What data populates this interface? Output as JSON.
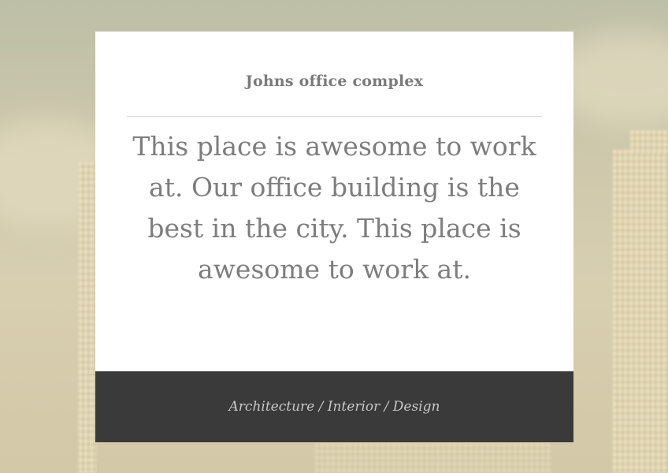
{
  "card": {
    "title": "Johns office complex",
    "quote": "This place is awesome to work at. Our office building is the best in the city. This place is awesome to work at.",
    "footer": "Architecture / Interior / Design"
  },
  "colors": {
    "card_background": "#ffffff",
    "footer_background": "#3a3a3a",
    "text_gray": "#7d7d7d"
  }
}
